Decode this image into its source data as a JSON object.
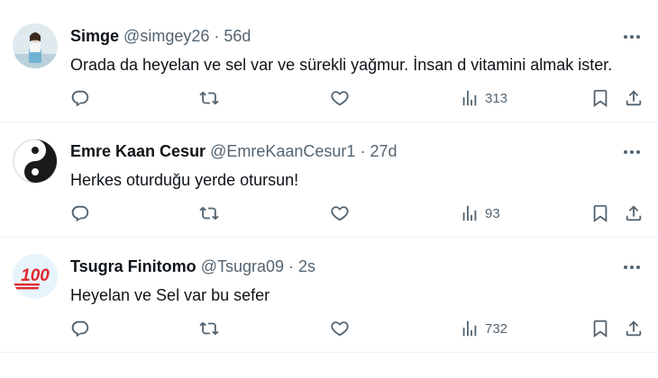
{
  "tweets": [
    {
      "name": "Simge",
      "handle": "@simgey26",
      "sep": "·",
      "time": "56d",
      "text": "Orada da heyelan ve sel var ve sürekli yağmur. İnsan d vitamini almak ister.",
      "views": "313",
      "avatar": "photo-avatar"
    },
    {
      "name": "Emre Kaan Cesur",
      "handle": "@EmreKaanCesur1",
      "sep": "·",
      "time": "27d",
      "text": "Herkes oturduğu yerde otursun!",
      "views": "93",
      "avatar": "yin-yang-avatar"
    },
    {
      "name": "Tsugra Finitomo",
      "handle": "@Tsugra09",
      "sep": "·",
      "time": "2s",
      "text": "Heyelan ve Sel var bu sefer",
      "views": "732",
      "avatar": "hundred-points-avatar"
    }
  ],
  "colors": {
    "text": "#0f1419",
    "muted": "#536471",
    "divider": "#eff3f4",
    "hundred_red": "#e0282e"
  }
}
